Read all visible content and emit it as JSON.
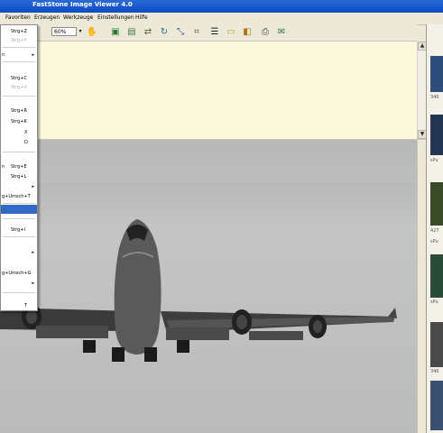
{
  "window": {
    "title": "FastStone Image Viewer 4.0"
  },
  "menubar": {
    "items": [
      "Favoriten",
      "Erzeugen",
      "Werkzeuge",
      "Einstellungen",
      "Hilfe"
    ]
  },
  "toolbar": {
    "zoom_value": "60%",
    "zoom_dropdown": "▾",
    "icons": [
      "hand-icon",
      "photo-icon",
      "photo-edit-icon",
      "flip-icon",
      "rotate-icon",
      "resize-icon",
      "crop-icon",
      "adjust-icon",
      "slideshow-icon",
      "compare-icon",
      "print-icon",
      "email-icon"
    ]
  },
  "context_menu": {
    "items": [
      {
        "label": "",
        "shortcut": "Strg+Z",
        "disabled": false
      },
      {
        "label": "",
        "shortcut": "Strg+Y",
        "disabled": true
      },
      {
        "label": "n",
        "shortcut": "",
        "disabled": false,
        "submenu": true
      },
      {
        "label": "",
        "shortcut": "Strg+C",
        "disabled": false
      },
      {
        "label": "",
        "shortcut": "Strg+V",
        "disabled": true
      },
      {
        "label": "",
        "shortcut": "Strg+R",
        "disabled": false
      },
      {
        "label": "",
        "shortcut": "Strg+K",
        "disabled": false
      },
      {
        "label": "",
        "shortcut": "X",
        "disabled": false
      },
      {
        "label": "",
        "shortcut": "D",
        "disabled": false
      },
      {
        "label": "n",
        "shortcut": "Strg+E",
        "disabled": false
      },
      {
        "label": "",
        "shortcut": "Strg+L",
        "disabled": false
      },
      {
        "label": "",
        "shortcut": "",
        "disabled": false,
        "submenu": true
      },
      {
        "label": "",
        "shortcut": "g+Umsch+T",
        "disabled": false
      },
      {
        "label": "",
        "shortcut": "",
        "disabled": false,
        "highlighted": true
      },
      {
        "label": "",
        "shortcut": "Strg+I",
        "disabled": false
      },
      {
        "label": "",
        "shortcut": "",
        "disabled": false,
        "submenu": true
      },
      {
        "label": "",
        "shortcut": "g+Umsch+G",
        "disabled": false
      },
      {
        "label": "",
        "shortcut": "",
        "disabled": false,
        "submenu": true
      },
      {
        "label": "",
        "shortcut": "T",
        "disabled": false
      }
    ]
  },
  "browser": {
    "captions": [
      "346",
      "sPu",
      "427",
      "sPu",
      "sPu",
      "346"
    ]
  },
  "colors": {
    "titlebar": "#0b4cc3",
    "highlight": "#316ac5",
    "menu_bg": "#ffffff",
    "info_bg": "#fbf8dc"
  }
}
